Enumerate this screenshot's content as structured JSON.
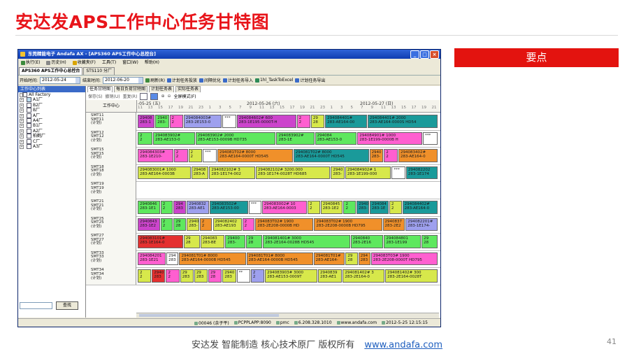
{
  "slide": {
    "title": "安达发APS工作中心任务甘特图",
    "keypoint_label": "要点",
    "footer_text": "安达发   智能制造 核心技术原厂   版权所有",
    "footer_link": "www.andafa.com",
    "page_number": "41"
  },
  "window": {
    "title": "东莞精能电子 Andafa AX - [APS360 APS工作中心总控台]",
    "menu": [
      "执行(E)",
      "历史(H)",
      "收藏夹(F)",
      "工具(T)",
      "窗口(W)",
      "帮助(H)"
    ],
    "doc_tabs": [
      "APS360 APS工作中心总控台",
      "STS110 分厂"
    ],
    "filter": {
      "start_label": "开始时间:",
      "start_value": "2012-05-24",
      "end_label": "结束时间:",
      "end_value": "2012-06-20",
      "buttons": [
        "刷新(R)",
        "计划任务投放",
        "间隔优化",
        "计划任务导入",
        "1hl_TaskToExcel",
        "计划任务导出"
      ]
    },
    "left_panel": {
      "header": "工作中心列表",
      "items": [
        "All Factory",
        "A1厂",
        "B2厂",
        "B厂",
        "A厂",
        "A4厂",
        "B1厂",
        "A2厂",
        "柏鹤厂",
        "C厂",
        "A3厂"
      ],
      "find_button": "查找"
    },
    "gantt_tabs": [
      "任务甘特图",
      "每日负荷甘特图",
      "计划任务表",
      "实际任务表"
    ],
    "gantt_toolbar": [
      "保存(S)",
      "撤销(U)",
      "重复(R)",
      "全屏模式(F)"
    ],
    "header": {
      "wc_label": "工作中心",
      "days": [
        "-05-25 (五)",
        "2012-05-26 (六)",
        "2012-05-27 (日)"
      ],
      "hours": [
        "11",
        "13",
        "15",
        "17",
        "19",
        "21",
        "23",
        "1",
        "3",
        "5",
        "7",
        "9",
        "11",
        "13",
        "15",
        "17",
        "19",
        "21",
        "23",
        "1",
        "3",
        "5",
        "7",
        "9",
        "11",
        "13",
        "15",
        "17",
        "19",
        "21"
      ]
    },
    "rows": [
      {
        "label": [
          "SMT11",
          "SMT11",
          "(计划)"
        ],
        "bars": [
          {
            "a": "29408",
            "b": "283-1",
            "c": "#cc44cc"
          },
          {
            "a": "2940",
            "b": "283-",
            "c": "#5ee85e"
          },
          {
            "a": "2",
            "b": "2",
            "c": "#ff5fd0"
          },
          {
            "a": "294084003#",
            "b": "283-2E153-0",
            "c": "#9ea0ee"
          },
          {
            "a": "***",
            "b": "",
            "c": "#ffffff"
          },
          {
            "a": "294084602# 600",
            "b": "283-1E195-0000T-H",
            "c": "#cc44cc"
          },
          {
            "a": "2",
            "b": "2",
            "c": "#ff5fd0"
          },
          {
            "a": "29",
            "b": "28",
            "c": "#d7e84b"
          },
          {
            "a": "294084401#",
            "b": "283-AE164-00",
            "c": "#1a9a9a"
          },
          {
            "a": "294084401# 2000",
            "b": "283-AE164-0000S HD54",
            "c": "#1a9a9a"
          }
        ]
      },
      {
        "label": [
          "SMT12",
          "SMT12",
          "(计划)"
        ],
        "bars": [
          {
            "a": "2",
            "b": "2",
            "c": "#5ee85e"
          },
          {
            "a": "294083902#",
            "b": "283-AE153-0",
            "c": "#5ee85e"
          },
          {
            "a": "294083902# 2000",
            "b": "283-AE153-0009B HD735",
            "c": "#5ee85e"
          },
          {
            "a": "294083902#",
            "b": "283-1E",
            "c": "#5ee85e"
          },
          {
            "a": "294084",
            "b": "283-AE153-0",
            "c": "#5ee85e"
          },
          {
            "a": "294084901# 1000",
            "b": "283-1E199-0000B H",
            "c": "#ff5fd0"
          },
          {
            "a": "***",
            "b": "",
            "c": "#ffffff"
          }
        ]
      },
      {
        "label": [
          "SMT15",
          "SMT15",
          "(计划)"
        ],
        "bars": [
          {
            "a": "294084303#",
            "b": "283-1E210-",
            "c": "#ff5fd0"
          },
          {
            "a": "2",
            "b": "2",
            "c": "#ff5fd0"
          },
          {
            "a": "2",
            "b": "2",
            "c": "#d7e84b"
          },
          {
            "a": "***",
            "b": "",
            "c": "#ffffff"
          },
          {
            "a": "294081T02# 8000",
            "b": "283-AE164-0000T HD545",
            "c": "#f0902a"
          },
          {
            "a": "294081T02# 8000",
            "b": "283-AE164-0000T HD545",
            "c": "#1a9a9a"
          },
          {
            "a": "2940",
            "b": "283-",
            "c": "#f0902a"
          },
          {
            "a": "2",
            "b": "2",
            "c": "#ff5fd0"
          },
          {
            "a": "294083402#",
            "b": "283-AE164-0",
            "c": "#f0902a"
          }
        ]
      },
      {
        "label": [
          "SMT18",
          "SMT18",
          "(计划)"
        ],
        "bars": [
          {
            "a": "294083001# 1000",
            "b": "283-AE164-0003B",
            "c": "#d7e84b"
          },
          {
            "a": "29408",
            "b": "283-A",
            "c": "#d7e84b"
          },
          {
            "a": "294082102# 3",
            "b": "283-1E174-002",
            "c": "#d7e84b"
          },
          {
            "a": "294082102# 3200.000",
            "b": "283-1E174-0028T HD685",
            "c": "#d7e84b"
          },
          {
            "a": "2940",
            "b": "283-",
            "c": "#d7e84b"
          },
          {
            "a": "294084902# 1",
            "b": "283-1E199-000",
            "c": "#d7e84b"
          },
          {
            "a": "***",
            "b": "",
            "c": "#ffffff"
          },
          {
            "a": "294082202",
            "b": "283-1E174",
            "c": "#1a9a9a"
          }
        ]
      },
      {
        "label": [
          "SMT19",
          "SMT19",
          "(计划)"
        ],
        "bars": []
      },
      {
        "label": [
          "SMT21",
          "SMT21",
          "(计划)"
        ],
        "bars": [
          {
            "a": "2940846",
            "b": "283-1E1",
            "c": "#5ee85e"
          },
          {
            "a": "2",
            "b": "2",
            "c": "#5ee85e"
          },
          {
            "a": "294",
            "b": "283",
            "c": "#cc44cc"
          },
          {
            "a": "2940832",
            "b": "283-AE1",
            "c": "#9ea0ee"
          },
          {
            "a": "294083502#",
            "b": "283-AE153-00",
            "c": "#1a9a9a"
          },
          {
            "a": "***",
            "b": "",
            "c": "#ffffff"
          },
          {
            "a": "294083002# 10",
            "b": "283-AE164-0003",
            "c": "#ff5fd0"
          },
          {
            "a": "2",
            "b": "2",
            "c": "#d7e84b"
          },
          {
            "a": "2940845",
            "b": "283-1E2",
            "c": "#d7e84b"
          },
          {
            "a": "2",
            "b": "2",
            "c": "#5ee85e"
          },
          {
            "a": "2940",
            "b": "283-",
            "c": "#1a9a9a"
          },
          {
            "a": "294084",
            "b": "283-1E",
            "c": "#1a9a9a"
          },
          {
            "a": "2",
            "b": "2",
            "c": "#d7e84b"
          },
          {
            "a": "294084402#",
            "b": "283-AE164-0",
            "c": "#1a9a9a"
          }
        ]
      },
      {
        "label": [
          "SMT25",
          "SMT25",
          "(计划)"
        ],
        "bars": [
          {
            "a": "2940843",
            "b": "283-1E2",
            "c": "#cc44cc"
          },
          {
            "a": "2",
            "b": "2",
            "c": "#5ee85e"
          },
          {
            "a": "29",
            "b": "28",
            "c": "#5ee85e"
          },
          {
            "a": "2940",
            "b": "283-",
            "c": "#d7e84b"
          },
          {
            "a": "2",
            "b": "2",
            "c": "#f0902a"
          },
          {
            "a": "294082402",
            "b": "283-AE193",
            "c": "#d7e84b"
          },
          {
            "a": "2",
            "b": "2",
            "c": "#ff5fd0"
          },
          {
            "a": "294083T02# 1900",
            "b": "283-2E208-0000B HD",
            "c": "#f0902a"
          },
          {
            "a": "294083T02# 1900",
            "b": "283-2E208-0000B HD795",
            "c": "#f0902a"
          },
          {
            "a": "2940837",
            "b": "283-2E2",
            "c": "#f0902a"
          },
          {
            "a": "294082201#",
            "b": "283-1E174-",
            "c": "#9ea0ee"
          }
        ]
      },
      {
        "label": [
          "SMT27",
          "SMT27",
          "(计划)"
        ],
        "bars": [
          {
            "a": "294083101#",
            "b": "283-1E164-0",
            "c": "#e43030"
          },
          {
            "a": "29",
            "b": "28",
            "c": "#d7e84b"
          },
          {
            "a": "294083",
            "b": "283-BE",
            "c": "#d7e84b"
          },
          {
            "a": "29400",
            "b": "283-",
            "c": "#5ee85e"
          },
          {
            "a": "29",
            "b": "28",
            "c": "#5ee85e"
          },
          {
            "a": "294081401# 3000",
            "b": "283-2E164-0028B HD545",
            "c": "#5ee85e"
          },
          {
            "a": "2940840",
            "b": "283-2E16",
            "c": "#5ee85e"
          },
          {
            "a": "294084801",
            "b": "283-1E199",
            "c": "#5ee85e"
          },
          {
            "a": "29",
            "b": "28",
            "c": "#5ee85e"
          }
        ]
      },
      {
        "label": [
          "SMT33",
          "SMT33",
          "(计划)"
        ],
        "bars": [
          {
            "a": "294084201",
            "b": "283-1E21",
            "c": "#ff5fd0"
          },
          {
            "a": "294",
            "b": "283",
            "c": "#ffffff"
          },
          {
            "a": "294081T01# 8000",
            "b": "283-AE164-0000B HD545",
            "c": "#f0902a"
          },
          {
            "a": "294081T01# 8000",
            "b": "283-AE164-0000B HD545",
            "c": "#f0902a"
          },
          {
            "a": "294081T01#",
            "b": "283-AE164-",
            "c": "#f0902a"
          },
          {
            "a": "29",
            "b": "28",
            "c": "#d7e84b"
          },
          {
            "a": "294",
            "b": "283",
            "c": "#f0902a"
          },
          {
            "a": "294083T03# 1900",
            "b": "283-2E208-0000T HD795",
            "c": "#ff5fd0"
          }
        ]
      },
      {
        "label": [
          "SMT34",
          "SMT34",
          "(计划)"
        ],
        "bars": [
          {
            "a": "2",
            "b": "2",
            "c": "#d7e84b"
          },
          {
            "a": "2940",
            "b": "283",
            "c": "#e43030"
          },
          {
            "a": "2",
            "b": "2",
            "c": "#ff5fd0"
          },
          {
            "a": "29",
            "b": "283",
            "c": "#d7e84b"
          },
          {
            "a": "29",
            "b": "283",
            "c": "#d7e84b"
          },
          {
            "a": "29",
            "b": "28",
            "c": "#ff5fd0"
          },
          {
            "a": "2940",
            "b": "283",
            "c": "#d7e84b"
          },
          {
            "a": "**",
            "b": "",
            "c": "#ffffff"
          },
          {
            "a": "2",
            "b": "2",
            "c": "#9ea0ee"
          },
          {
            "a": "294083903# 3000",
            "b": "283-AE153-0009T",
            "c": "#d7e84b"
          },
          {
            "a": "2940839",
            "b": "283-AE1",
            "c": "#d7e84b"
          },
          {
            "a": "294081402# 3",
            "b": "283-2E164-0",
            "c": "#d7e84b"
          },
          {
            "a": "294081402# 300",
            "b": "283-2E164-0028T",
            "c": "#d7e84b"
          }
        ]
      }
    ],
    "status": [
      "00046 (余子平)",
      "PCPPLAPP:8090",
      "pmc",
      "6.208.328.1010",
      "www.andafa.com",
      "2012-5-25 12:15:15"
    ]
  }
}
